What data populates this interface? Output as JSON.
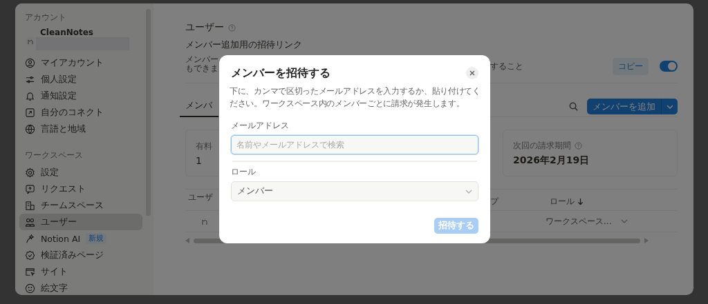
{
  "sidebar": {
    "sections": [
      {
        "title": "アカウント",
        "account": {
          "name": "CleanNotes"
        },
        "items": [
          {
            "label": "マイアカウント",
            "selected": false
          },
          {
            "label": "個人設定",
            "selected": false
          },
          {
            "label": "通知設定",
            "selected": false
          },
          {
            "label": "自分のコネクト",
            "selected": false
          },
          {
            "label": "言語と地域",
            "selected": false
          }
        ]
      },
      {
        "title": "ワークスペース",
        "items": [
          {
            "label": "設定",
            "selected": false
          },
          {
            "label": "リクエスト",
            "selected": false
          },
          {
            "label": "チームスペース",
            "selected": false
          },
          {
            "label": "ユーザー",
            "selected": true
          },
          {
            "label": "Notion AI",
            "badge": "新規",
            "selected": false
          },
          {
            "label": "検証済みページ",
            "selected": false
          },
          {
            "label": "サイト",
            "selected": false
          },
          {
            "label": "絵文字",
            "selected": false
          }
        ]
      }
    ]
  },
  "page": {
    "title": "ユーザー",
    "invite_link": {
      "title": "メンバー追加用の招待リンク",
      "description_start": [
        "メンバー",
        "もできま"
      ],
      "description_end": "すること",
      "copy_button": "コピー",
      "on": true
    },
    "tabs": [
      {
        "label": "メンバ",
        "selected": true
      }
    ],
    "add_member_button": "メンバーを追加",
    "stats": [
      {
        "label": "有料",
        "value": "1"
      },
      {
        "label": "次回の請求期間",
        "value": "2026年2月19日"
      }
    ],
    "table": {
      "columns": [
        "ユーザ",
        "プ",
        "ロール"
      ],
      "rows": [
        {
          "role": "ワークスペース..."
        }
      ]
    }
  },
  "dialog": {
    "title": "メンバーを招待する",
    "description": "下に、カンマで区切ったメールアドレスを入力するか、貼り付けてください。ワークスペース内のメンバーごとに請求が発生します。",
    "email_label": "メールアドレス",
    "email_placeholder": "名前やメールアドレスで検索",
    "role_label": "ロール",
    "role_value": "メンバー",
    "submit_button": {
      "label": "招待する",
      "disabled": true
    }
  }
}
